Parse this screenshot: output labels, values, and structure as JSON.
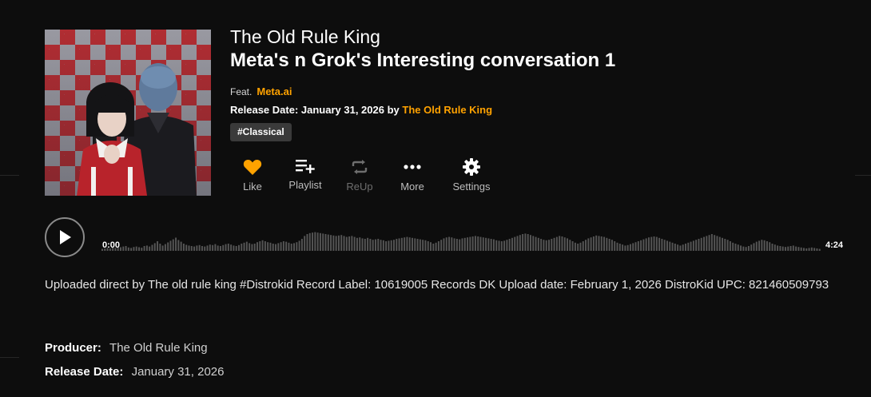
{
  "track": {
    "artist": "The Old Rule King",
    "title": "Meta's n Grok's Interesting conversation 1",
    "feat_label": "Feat.",
    "feat_artist": "Meta.ai",
    "release_label": "Release Date: January 31, 2026 by",
    "release_by": "The Old Rule King",
    "tag": "#Classical"
  },
  "actions": [
    {
      "label": "Like",
      "icon": "heart-icon",
      "color": "#ffa200"
    },
    {
      "label": "Playlist",
      "icon": "playlist-add-icon"
    },
    {
      "label": "ReUp",
      "icon": "repost-icon"
    },
    {
      "label": "More",
      "icon": "more-dots-icon"
    },
    {
      "label": "Settings",
      "icon": "gear-icon"
    }
  ],
  "player": {
    "current_time": "0:00",
    "duration": "4:24",
    "waveform_levels": [
      0.08,
      0.1,
      0.12,
      0.1,
      0.14,
      0.12,
      0.16,
      0.15,
      0.18,
      0.2,
      0.14,
      0.12,
      0.16,
      0.18,
      0.15,
      0.13,
      0.2,
      0.22,
      0.18,
      0.25,
      0.32,
      0.4,
      0.3,
      0.22,
      0.28,
      0.35,
      0.42,
      0.48,
      0.55,
      0.45,
      0.38,
      0.3,
      0.25,
      0.22,
      0.2,
      0.18,
      0.22,
      0.24,
      0.2,
      0.18,
      0.22,
      0.26,
      0.24,
      0.28,
      0.22,
      0.2,
      0.24,
      0.28,
      0.3,
      0.26,
      0.22,
      0.2,
      0.24,
      0.3,
      0.34,
      0.38,
      0.32,
      0.28,
      0.3,
      0.36,
      0.4,
      0.44,
      0.4,
      0.36,
      0.34,
      0.3,
      0.28,
      0.32,
      0.36,
      0.4,
      0.38,
      0.34,
      0.3,
      0.32,
      0.36,
      0.42,
      0.5,
      0.62,
      0.7,
      0.74,
      0.76,
      0.78,
      0.76,
      0.74,
      0.72,
      0.7,
      0.68,
      0.66,
      0.64,
      0.62,
      0.64,
      0.66,
      0.62,
      0.58,
      0.6,
      0.62,
      0.58,
      0.54,
      0.56,
      0.52,
      0.5,
      0.54,
      0.5,
      0.46,
      0.48,
      0.5,
      0.46,
      0.44,
      0.4,
      0.42,
      0.44,
      0.46,
      0.5,
      0.52,
      0.54,
      0.56,
      0.58,
      0.56,
      0.54,
      0.52,
      0.5,
      0.48,
      0.46,
      0.44,
      0.4,
      0.36,
      0.3,
      0.34,
      0.4,
      0.46,
      0.52,
      0.56,
      0.58,
      0.56,
      0.52,
      0.5,
      0.48,
      0.52,
      0.54,
      0.56,
      0.58,
      0.6,
      0.62,
      0.6,
      0.58,
      0.56,
      0.54,
      0.52,
      0.5,
      0.48,
      0.44,
      0.42,
      0.4,
      0.42,
      0.46,
      0.5,
      0.54,
      0.58,
      0.62,
      0.66,
      0.7,
      0.72,
      0.7,
      0.66,
      0.62,
      0.58,
      0.54,
      0.5,
      0.46,
      0.44,
      0.46,
      0.5,
      0.54,
      0.58,
      0.62,
      0.6,
      0.56,
      0.52,
      0.46,
      0.4,
      0.34,
      0.3,
      0.34,
      0.4,
      0.46,
      0.52,
      0.56,
      0.6,
      0.64,
      0.62,
      0.6,
      0.58,
      0.54,
      0.5,
      0.46,
      0.4,
      0.34,
      0.3,
      0.26,
      0.22,
      0.24,
      0.28,
      0.32,
      0.36,
      0.4,
      0.44,
      0.48,
      0.52,
      0.56,
      0.58,
      0.6,
      0.58,
      0.54,
      0.5,
      0.46,
      0.42,
      0.38,
      0.34,
      0.3,
      0.26,
      0.22,
      0.26,
      0.3,
      0.34,
      0.38,
      0.42,
      0.46,
      0.5,
      0.54,
      0.58,
      0.62,
      0.66,
      0.7,
      0.66,
      0.62,
      0.58,
      0.54,
      0.5,
      0.46,
      0.4,
      0.34,
      0.3,
      0.26,
      0.22,
      0.18,
      0.16,
      0.2,
      0.26,
      0.32,
      0.38,
      0.42,
      0.46,
      0.44,
      0.4,
      0.36,
      0.3,
      0.26,
      0.22,
      0.2,
      0.18,
      0.16,
      0.18,
      0.2,
      0.22,
      0.18,
      0.16,
      0.14,
      0.12,
      0.1,
      0.12,
      0.14,
      0.12,
      0.1,
      0.08
    ]
  },
  "description": "Uploaded direct by The old rule king #Distrokid Record Label: 10619005 Records DK Upload date: February 1, 2026 DistroKid UPC: 821460509793",
  "meta": {
    "producer_label": "Producer:",
    "producer_value": "The Old Rule King",
    "release_label": "Release Date:",
    "release_value": "January 31, 2026"
  },
  "colors": {
    "accent": "#ffa200",
    "background": "#0d0d0d",
    "waveform": "#555555"
  }
}
